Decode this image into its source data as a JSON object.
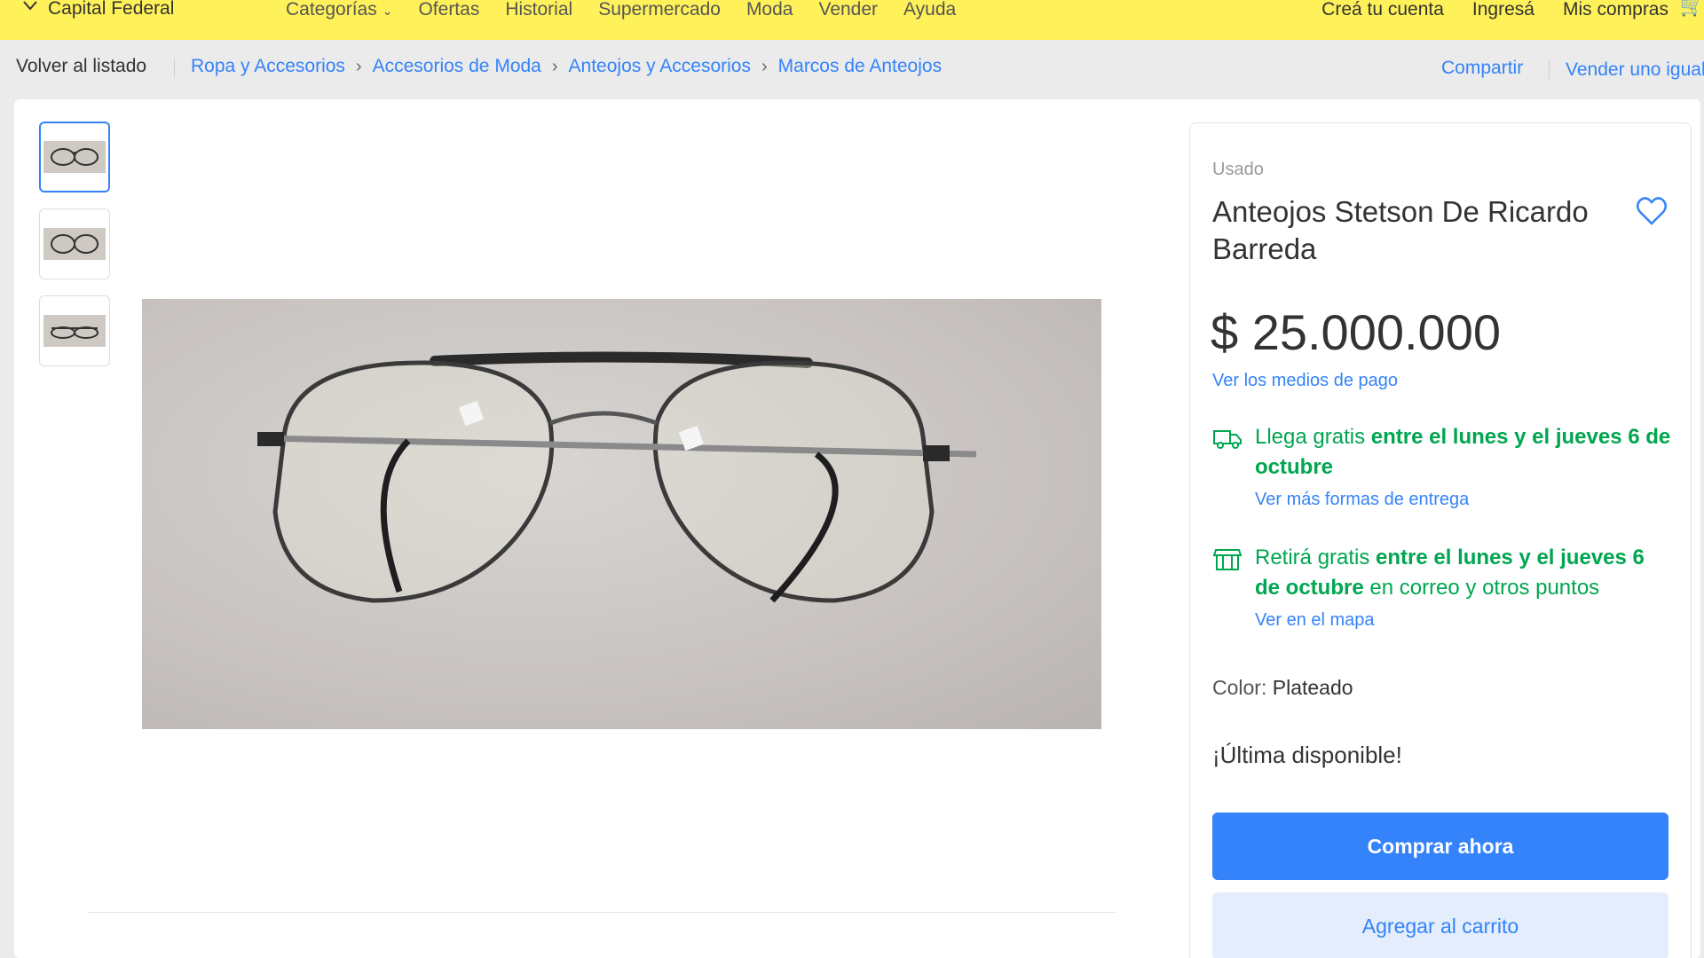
{
  "header": {
    "location": "Capital Federal",
    "nav_left": [
      "Categorías",
      "Ofertas",
      "Historial",
      "Supermercado",
      "Moda",
      "Vender",
      "Ayuda"
    ],
    "nav_right": [
      "Creá tu cuenta",
      "Ingresá",
      "Mis compras"
    ]
  },
  "breadcrumb": {
    "back": "Volver al listado",
    "items": [
      "Ropa y Accesorios",
      "Accesorios de Moda",
      "Anteojos y Accesorios",
      "Marcos de Anteojos"
    ],
    "share": "Compartir",
    "sell_same": "Vender uno igual"
  },
  "gallery": {
    "thumbnails": [
      "thumb-1",
      "thumb-2",
      "thumb-3"
    ],
    "active_index": 0
  },
  "product": {
    "condition": "Usado",
    "title": "Anteojos Stetson De Ricardo Barreda",
    "price": "$ 25.000.000",
    "payment_link": "Ver los medios de pago",
    "shipping": {
      "lead": "Llega gratis",
      "bold": "entre el lunes y el jueves 6 de octubre",
      "link": "Ver más formas de entrega"
    },
    "pickup": {
      "lead": "Retirá gratis",
      "bold": "entre el lunes y el jueves 6 de octubre",
      "rest": "en correo y otros puntos",
      "link": "Ver en el mapa"
    },
    "color_label": "Color:",
    "color_value": "Plateado",
    "stock_note": "¡Última disponible!",
    "buy_button": "Comprar ahora",
    "cart_button": "Agregar al carrito"
  },
  "colors": {
    "header_yellow": "#fff159",
    "accent_blue": "#3483fa",
    "success_green": "#00a650"
  }
}
